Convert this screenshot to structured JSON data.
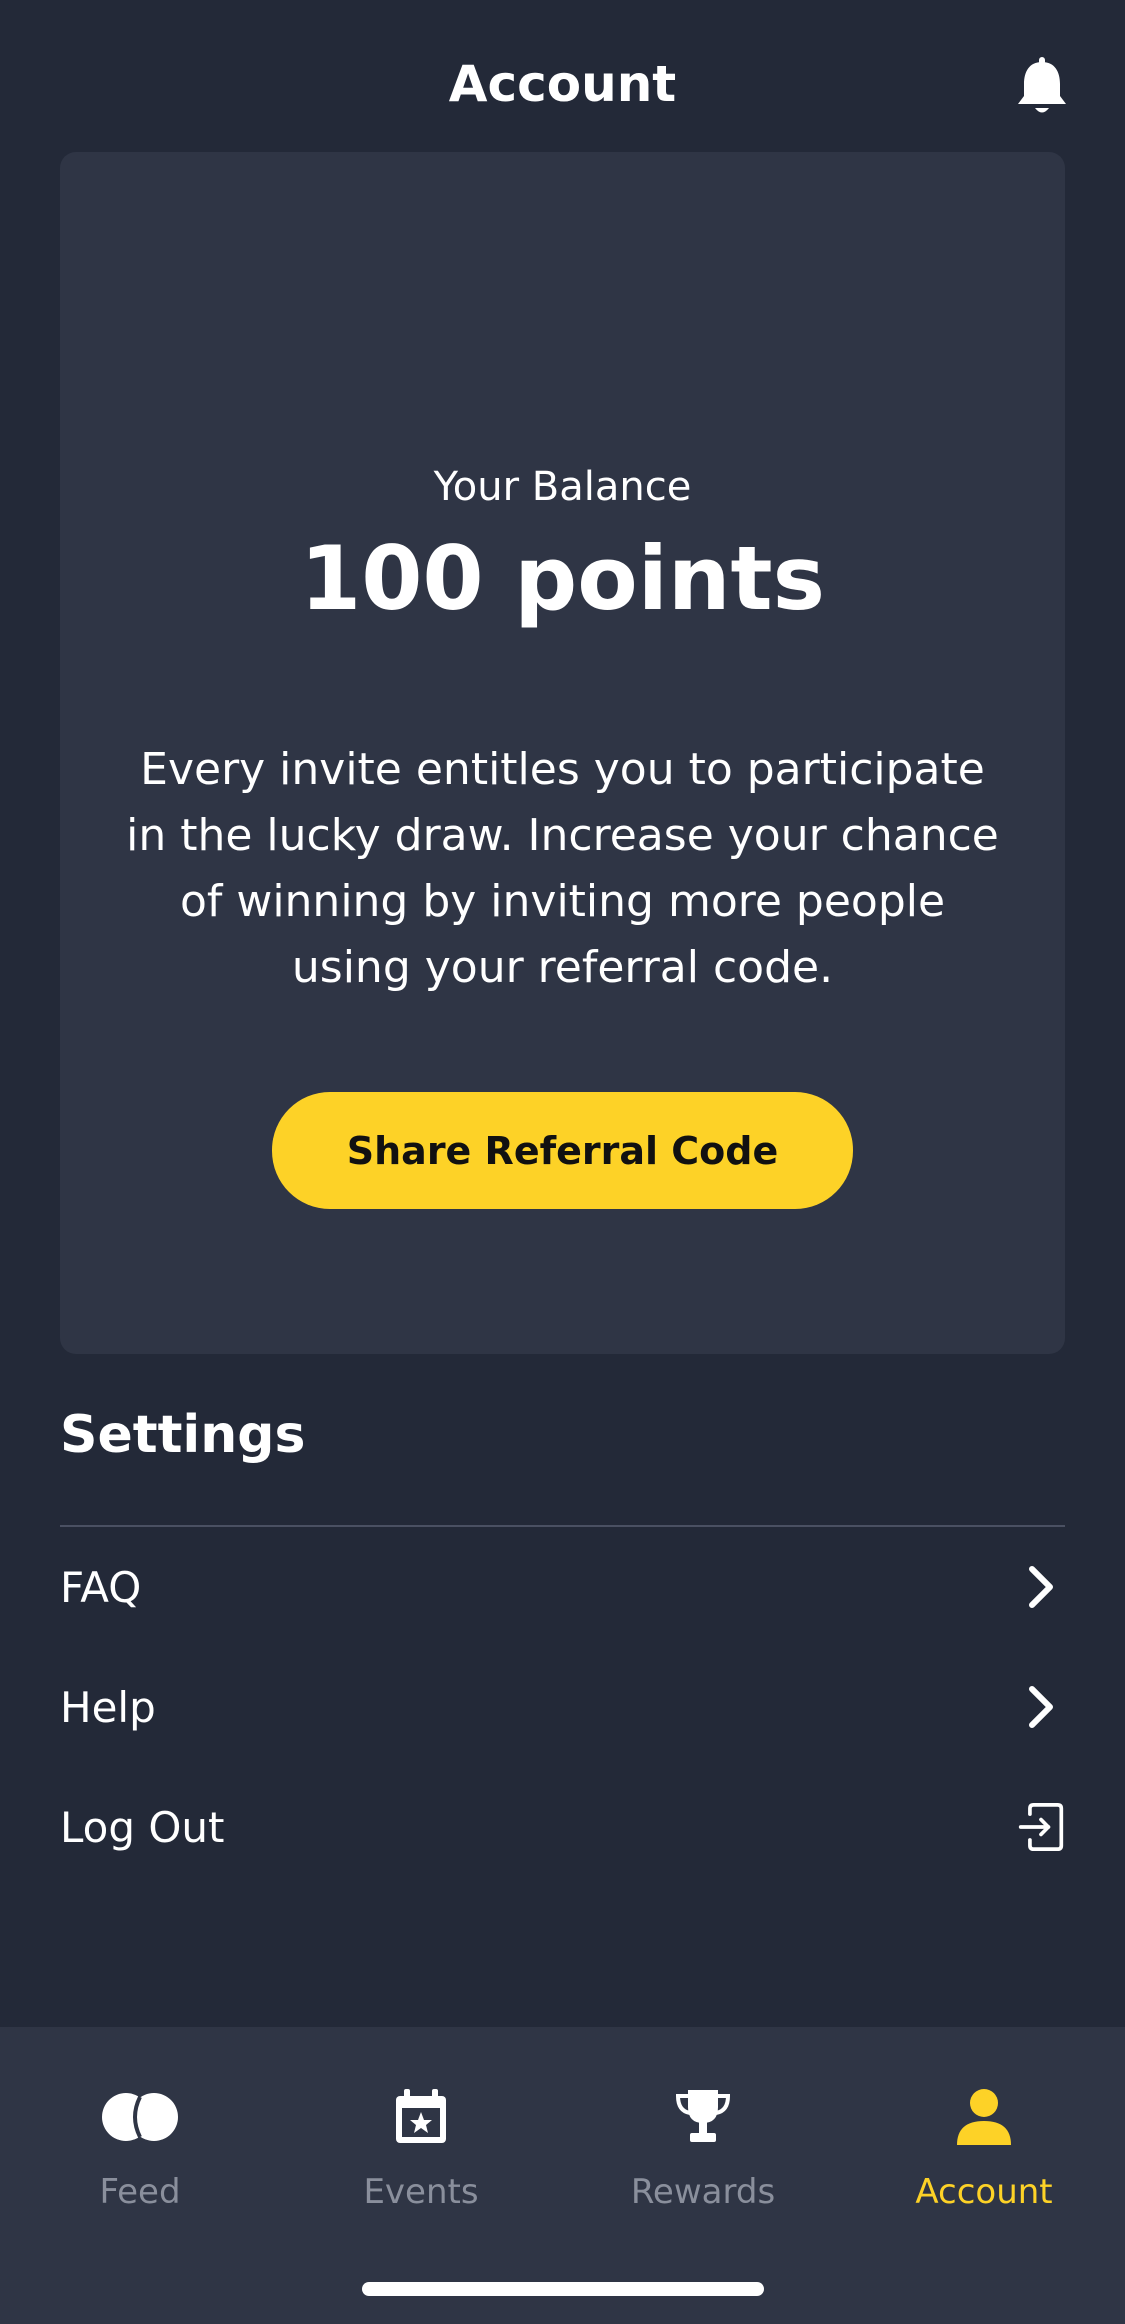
{
  "header": {
    "title": "Account",
    "notification_icon": "bell-icon"
  },
  "balance": {
    "label": "Your Balance",
    "value": "100 points",
    "description": "Every invite entitles you to participate in the lucky draw. Increase your chance of winning by inviting more people using your referral code.",
    "share_button_label": "Share Referral Code"
  },
  "settings": {
    "title": "Settings",
    "items": [
      {
        "label": "FAQ",
        "icon": "chevron-right-icon"
      },
      {
        "label": "Help",
        "icon": "chevron-right-icon"
      },
      {
        "label": "Log Out",
        "icon": "logout-icon"
      }
    ]
  },
  "bottom_nav": {
    "items": [
      {
        "label": "Feed",
        "icon": "feed-icon",
        "active": false
      },
      {
        "label": "Events",
        "icon": "calendar-star-icon",
        "active": false
      },
      {
        "label": "Rewards",
        "icon": "trophy-icon",
        "active": false
      },
      {
        "label": "Account",
        "icon": "user-icon",
        "active": true
      }
    ]
  },
  "colors": {
    "background": "#232938",
    "card": "#2f3545",
    "accent": "#fdd227",
    "inactive": "#8a8f9c",
    "text": "#ffffff"
  }
}
